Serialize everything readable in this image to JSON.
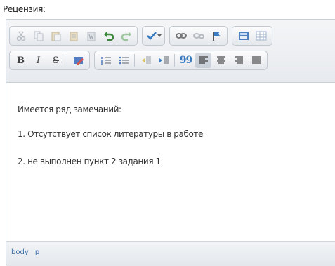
{
  "field_label": "Рецензия:",
  "toolbar": {
    "row1": [
      [
        "cut-icon",
        "copy-icon",
        "paste-icon",
        "paste-text-icon",
        "paste-word-icon",
        "undo-icon",
        "redo-icon"
      ],
      [
        "spellcheck-icon"
      ],
      [
        "link-icon",
        "unlink-icon",
        "anchor-icon"
      ],
      [
        "image-icon",
        "table-icon"
      ]
    ],
    "row2": {
      "bold_label": "B",
      "italic_label": "I",
      "strike_label": "S",
      "blockquote_label": "99"
    }
  },
  "content": {
    "line1": "Имеется ряд замечаний:",
    "line2": "1. Отсутствует список литературы в работе",
    "line3": "2. не выполнен пункт 2 задания 1"
  },
  "status": {
    "path_body": "body",
    "path_p": "p"
  },
  "colors": {
    "border": "#c9cfd6",
    "toolbar_bg": "#e7eaee",
    "path_link": "#3a6ea5"
  }
}
